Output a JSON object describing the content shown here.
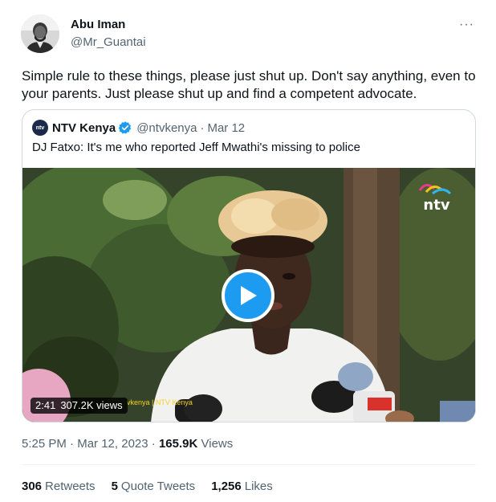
{
  "author": {
    "name": "Abu Iman",
    "handle": "@Mr_Guantai",
    "text": "Simple rule to these things, please just shut up. Don't say anything, even to your parents. Just please shut up and find a competent advocate."
  },
  "more_label": "···",
  "quoted": {
    "name": "NTV Kenya",
    "handle": "@ntvkenya",
    "separator": "·",
    "date": "Mar 12",
    "text": "DJ Fatxo: It's me who reported Jeff Mwathi's missing to police",
    "logo_text": "ntv",
    "video": {
      "duration": "2:41",
      "views": "307.2K views",
      "brand": "ntv",
      "caption": "vkenya | NTV Kenya"
    }
  },
  "meta": {
    "time": "5:25 PM",
    "separator": "·",
    "date": "Mar 12, 2023",
    "views_count": "165.9K",
    "views_label": "Views"
  },
  "stats": {
    "retweets_count": "306",
    "retweets_label": "Retweets",
    "quotes_count": "5",
    "quotes_label": "Quote Tweets",
    "likes_count": "1,256",
    "likes_label": "Likes"
  },
  "colors": {
    "accent": "#1d9bf0",
    "secondary_text": "#536471",
    "border": "#cfd9de"
  }
}
